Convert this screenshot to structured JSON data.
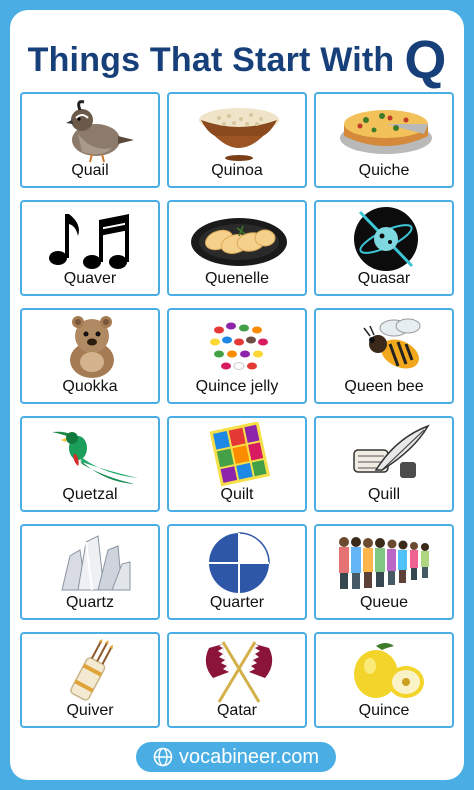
{
  "title": {
    "main": "Things That Start With",
    "letter": "Q"
  },
  "items": [
    {
      "label": "Quail",
      "icon": "quail-icon"
    },
    {
      "label": "Quinoa",
      "icon": "quinoa-icon"
    },
    {
      "label": "Quiche",
      "icon": "quiche-icon"
    },
    {
      "label": "Quaver",
      "icon": "quaver-icon"
    },
    {
      "label": "Quenelle",
      "icon": "quenelle-icon"
    },
    {
      "label": "Quasar",
      "icon": "quasar-icon"
    },
    {
      "label": "Quokka",
      "icon": "quokka-icon"
    },
    {
      "label": "Quince jelly",
      "icon": "quince-jelly-icon"
    },
    {
      "label": "Queen bee",
      "icon": "queen-bee-icon"
    },
    {
      "label": "Quetzal",
      "icon": "quetzal-icon"
    },
    {
      "label": "Quilt",
      "icon": "quilt-icon"
    },
    {
      "label": "Quill",
      "icon": "quill-icon"
    },
    {
      "label": "Quartz",
      "icon": "quartz-icon"
    },
    {
      "label": "Quarter",
      "icon": "quarter-icon"
    },
    {
      "label": "Queue",
      "icon": "queue-icon"
    },
    {
      "label": "Quiver",
      "icon": "quiver-icon"
    },
    {
      "label": "Qatar",
      "icon": "qatar-icon"
    },
    {
      "label": "Quince",
      "icon": "quince-icon"
    }
  ],
  "footer": {
    "text": "vocabineer.com",
    "icon": "globe-icon"
  },
  "colors": {
    "border": "#4aaee4",
    "title": "#17407a"
  }
}
